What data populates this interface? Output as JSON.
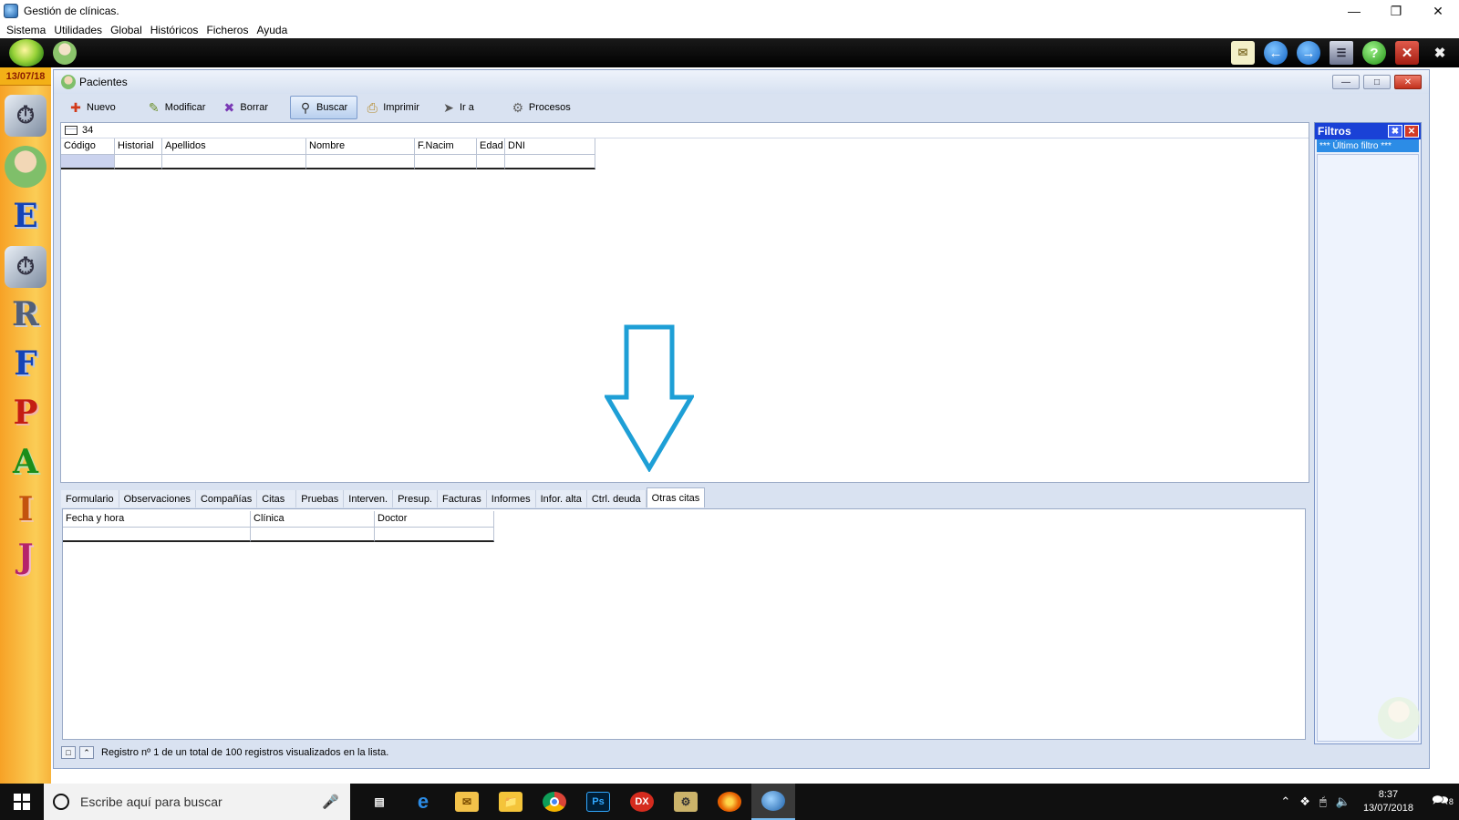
{
  "window": {
    "title": "Gestión de clínicas."
  },
  "menu": [
    "Sistema",
    "Utilidades",
    "Global",
    "Históricos",
    "Ficheros",
    "Ayuda"
  ],
  "dock": {
    "date": "13/07/18"
  },
  "patients": {
    "title": "Pacientes",
    "toolbar": [
      "Nuevo",
      "Modificar",
      "Borrar",
      "Buscar",
      "Imprimir",
      "Ir a",
      "Procesos"
    ],
    "active_tool": "Buscar",
    "count": "34",
    "columns": [
      "Código",
      "Historial",
      "Apellidos",
      "Nombre",
      "F.Nacim",
      "Edad",
      "DNI"
    ]
  },
  "filters": {
    "title": "Filtros",
    "item": "*** Último filtro ***"
  },
  "tabs": [
    "Formulario",
    "Observaciones",
    "Compañías",
    "Citas",
    "Pruebas",
    "Interven.",
    "Presup.",
    "Facturas",
    "Informes",
    "Infor. alta",
    "Ctrl. deuda",
    "Otras citas"
  ],
  "active_tab": "Otras citas",
  "detail_columns": [
    "Fecha y hora",
    "Clínica",
    "Doctor"
  ],
  "status": "Registro nº 1 de un total de 100 registros visualizados en la lista.",
  "taskbar": {
    "search_placeholder": "Escribe aquí para buscar",
    "apps": [
      "edge-icon",
      "mail-icon",
      "explorer-icon",
      "chrome-icon",
      "photoshop-icon",
      "dx-icon",
      "clinic-icon",
      "firefox-icon",
      "clinic-active-icon"
    ],
    "ps_label": "Ps",
    "dx_label": "DX",
    "time": "8:37",
    "date": "13/07/2018",
    "notifications": "8"
  },
  "colors": {
    "accent_arrow": "#1e9fd6",
    "filters_header": "#1a41d6",
    "dock": "#f7a226"
  }
}
